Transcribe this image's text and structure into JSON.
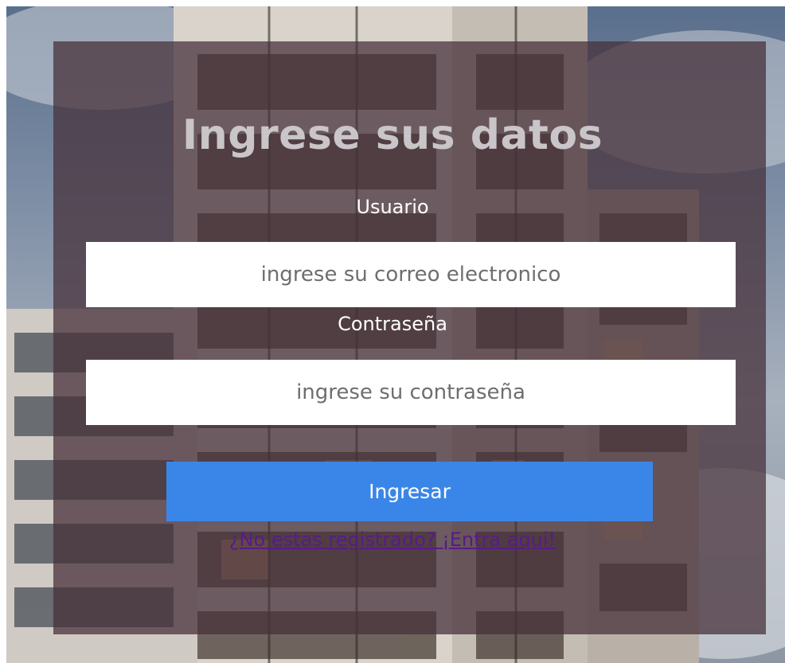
{
  "login": {
    "title": "Ingrese sus datos",
    "user_label": "Usuario",
    "user_placeholder": "ingrese su correo electronico",
    "password_label": "Contraseña",
    "password_placeholder": "ingrese su contraseña",
    "submit_label": "Ingresar",
    "register_link": "¿No estas registrado? ¡Entra aqui!"
  },
  "colors": {
    "overlay": "#46303a",
    "button": "#3a86e8",
    "link": "#5a1a8a",
    "title": "#c9c5c8"
  }
}
